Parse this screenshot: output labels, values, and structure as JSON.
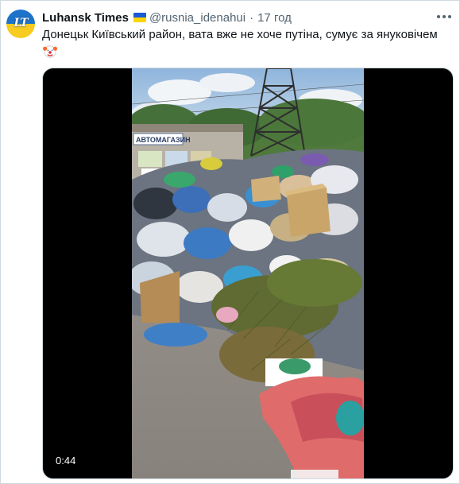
{
  "account": {
    "name": "Luhansk Times",
    "handle": "@rusnia_idenahui",
    "time": "17 год",
    "avatar_text": "LT"
  },
  "tweet": {
    "text": "Донецьк Київський район, вата вже не хоче путіна, сумує за януковічем",
    "emoji": "clown-face"
  },
  "media": {
    "duration": "0:44",
    "shop_sign": "АВТОМАГАЗИН"
  },
  "icons": {
    "more": "more-options-icon",
    "flag": "ukraine-flag-icon"
  },
  "colors": {
    "text": "#0f1419",
    "secondary": "#536471",
    "border": "#cfd9de",
    "flag_blue": "#1a5bd6",
    "flag_yellow": "#ffd500"
  }
}
